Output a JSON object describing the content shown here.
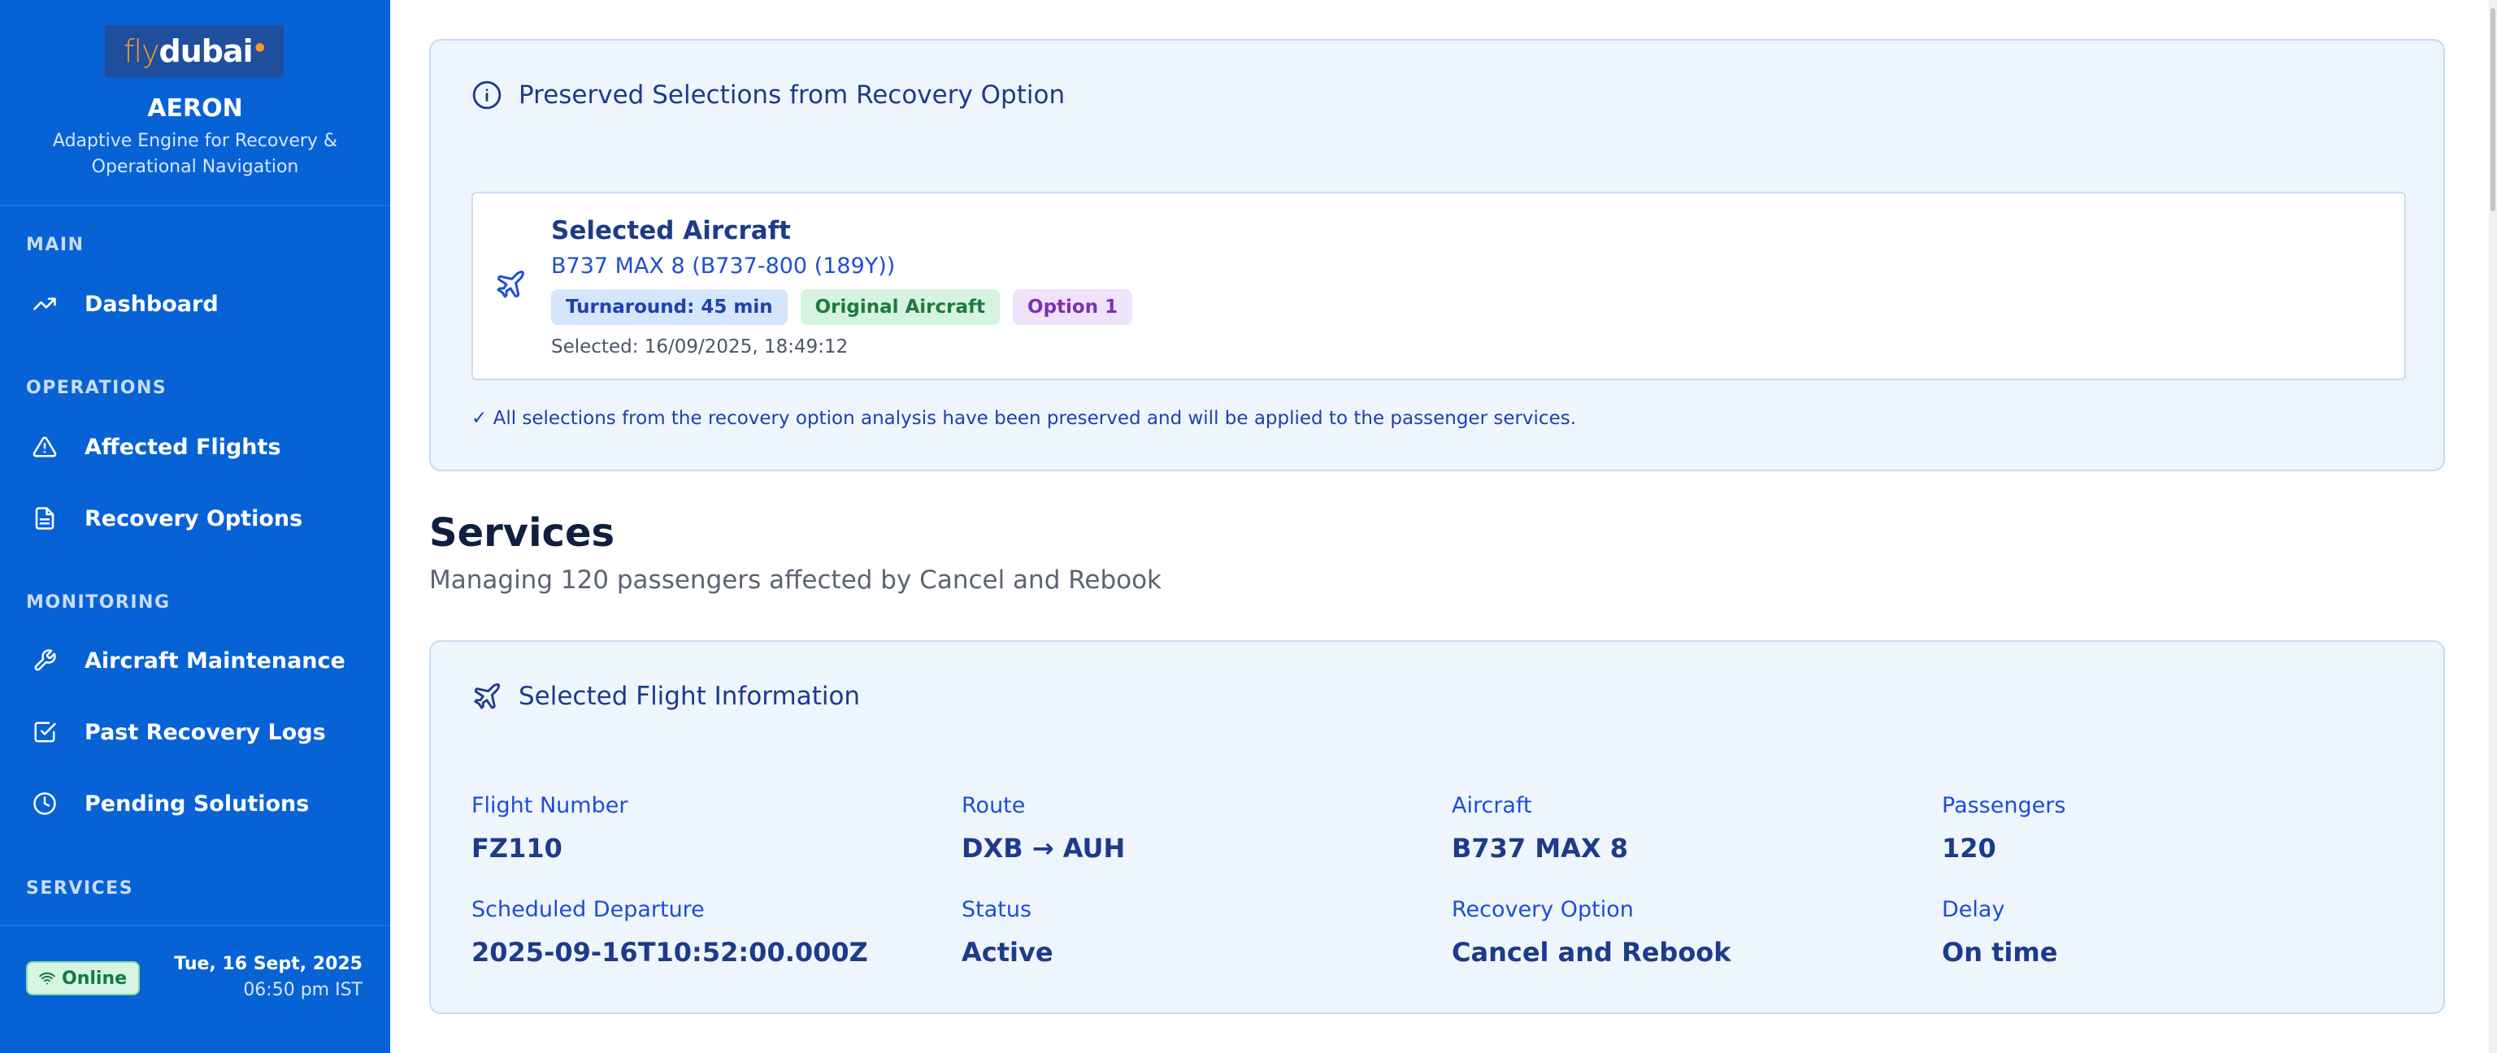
{
  "brand": {
    "logo_fly": "fly",
    "logo_dubai": "dubai",
    "app_name": "AERON",
    "tagline": "Adaptive Engine for Recovery & Operational Navigation"
  },
  "sidebar": {
    "sections": [
      {
        "label": "MAIN",
        "items": [
          {
            "label": "Dashboard",
            "icon": "trending-up-icon"
          }
        ]
      },
      {
        "label": "OPERATIONS",
        "items": [
          {
            "label": "Affected Flights",
            "icon": "alert-triangle-icon"
          },
          {
            "label": "Recovery Options",
            "icon": "file-text-icon"
          }
        ]
      },
      {
        "label": "MONITORING",
        "items": [
          {
            "label": "Aircraft Maintenance",
            "icon": "wrench-icon"
          },
          {
            "label": "Past Recovery Logs",
            "icon": "check-square-icon"
          },
          {
            "label": "Pending Solutions",
            "icon": "clock-icon"
          }
        ]
      },
      {
        "label": "SERVICES",
        "items": []
      }
    ],
    "status": "Online",
    "date": "Tue, 16 Sept, 2025",
    "time": "06:50 pm IST"
  },
  "preserved": {
    "title": "Preserved Selections from Recovery Option",
    "selected_title": "Selected Aircraft",
    "aircraft": "B737 MAX 8 (B737-800 (189Y))",
    "badges": [
      "Turnaround: 45 min",
      "Original Aircraft",
      "Option 1"
    ],
    "selected_at": "Selected: 16/09/2025, 18:49:12",
    "note": "✓ All selections from the recovery option analysis have been preserved and will be applied to the passenger services."
  },
  "services": {
    "title": "Services",
    "subtitle": "Managing 120 passengers affected by Cancel and Rebook"
  },
  "flight_info": {
    "title": "Selected Flight Information",
    "fields": [
      {
        "label": "Flight Number",
        "value": "FZ110"
      },
      {
        "label": "Route",
        "value": "DXB → AUH"
      },
      {
        "label": "Aircraft",
        "value": "B737 MAX 8"
      },
      {
        "label": "Passengers",
        "value": "120"
      },
      {
        "label": "Scheduled Departure",
        "value": "2025-09-16T10:52:00.000Z"
      },
      {
        "label": "Status",
        "value": "Active"
      },
      {
        "label": "Recovery Option",
        "value": "Cancel and Rebook"
      },
      {
        "label": "Delay",
        "value": "On time"
      }
    ]
  },
  "colors": {
    "sidebar": "#0762d6",
    "accent": "#1e3a8a",
    "card_bg": "#eef5fd"
  }
}
